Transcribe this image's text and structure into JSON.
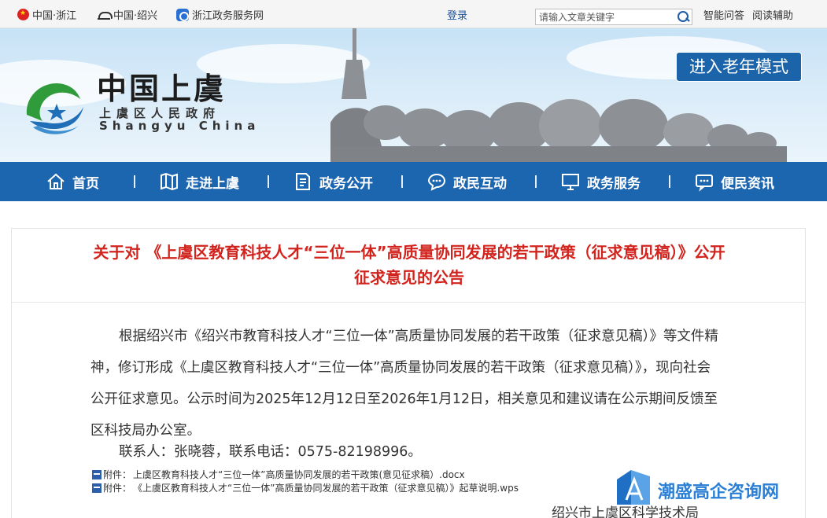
{
  "topbar": {
    "emblem_link": "中国·浙江",
    "shaoxing_link": "中国·绍兴",
    "portal_link": "浙江政务服务网",
    "login": "登录",
    "search_placeholder": "请输入文章关键字",
    "smart_qa": "智能问答",
    "reading_aid": "阅读辅助"
  },
  "banner": {
    "site_name": "中国上虞",
    "site_sub": "上虞区人民政府",
    "site_en": "Shangyu China",
    "elder_mode": "进入老年模式"
  },
  "nav": {
    "items": [
      {
        "label": "首页",
        "icon": "home-icon"
      },
      {
        "label": "走进上虞",
        "icon": "map-icon"
      },
      {
        "label": "政务公开",
        "icon": "document-icon"
      },
      {
        "label": "政民互动",
        "icon": "chat-icon"
      },
      {
        "label": "政务服务",
        "icon": "monitor-icon"
      },
      {
        "label": "便民资讯",
        "icon": "message-icon"
      }
    ]
  },
  "article": {
    "title": "关于对 《上虞区教育科技人才“三位一体”高质量协同发展的若干政策（征求意见稿）》公开征求意见的公告",
    "body": "根据绍兴市《绍兴市教育科技人才“三位一体”高质量协同发展的若干政策（征求意见稿）》等文件精神，修订形成《上虞区教育科技人才“三位一体”高质量协同发展的若干政策（征求意见稿）》，现向社会公开征求意见。公示时间为2025年12月12日至2026年1月12日，相关意见和建议请在公示期间反馈至区科技局办公室。",
    "contact": "联系人：张晓蓉，联系电话：0575-82198996。",
    "attachments": [
      {
        "prefix": "附件：",
        "name": "上虞区教育科技人才“三位一体”高质量协同发展的若干政策(意见征求稿）.docx"
      },
      {
        "prefix": "附件：",
        "name": "《上虞区教育科技人才“三位一体”高质量协同发展的若干政策（征求意见稿）》起草说明.wps"
      }
    ],
    "signature": "绍兴市上虞区科学技术局"
  },
  "watermark": {
    "text": "潮盛高企咨询网"
  },
  "colors": {
    "nav_bg": "#1c66b0",
    "title_red": "#d2231d",
    "elder_btn": "#1c64aa",
    "watermark_blue": "#2b7fd4"
  }
}
